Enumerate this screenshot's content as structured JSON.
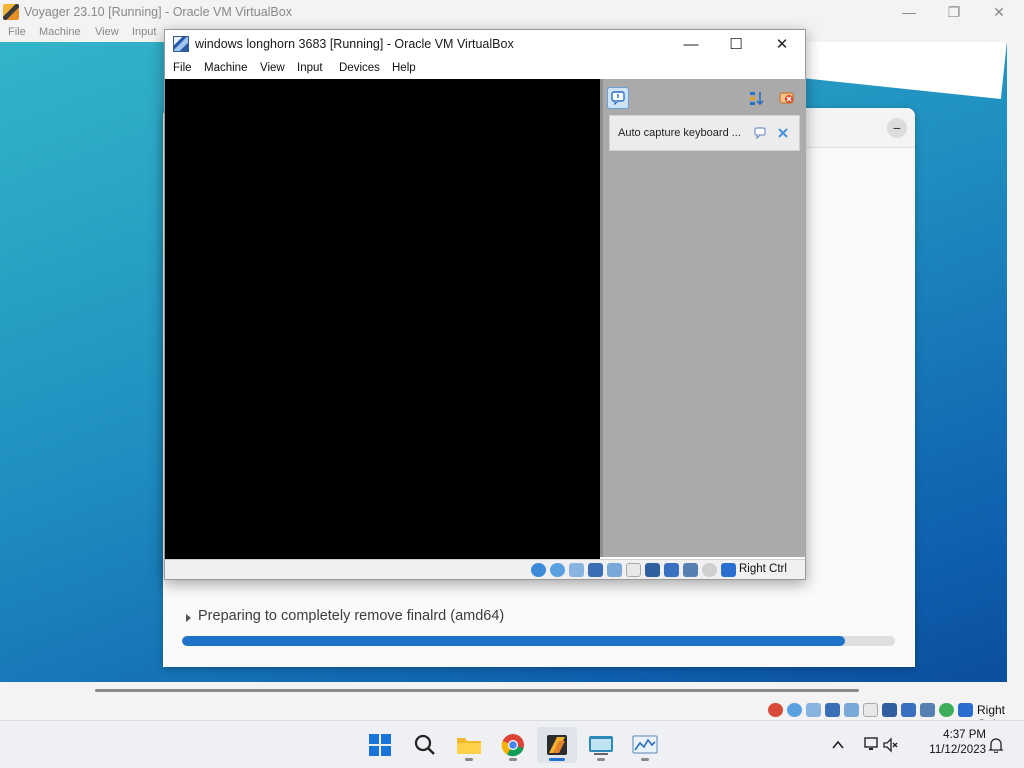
{
  "outer_window": {
    "title": "Voyager 23.10 [Running] - Oracle VM VirtualBox",
    "controls": {
      "minimize": "—",
      "maximize": "❐",
      "close": "✕"
    },
    "menu": [
      "File",
      "Machine",
      "View",
      "Input"
    ],
    "host_key": "Right Ctrl"
  },
  "installer": {
    "minimize_glyph": "−",
    "status_text": "Preparing to completely remove finalrd (amd64)",
    "progress_fraction": 0.93,
    "progress_color": "#1e73c8"
  },
  "inner_window": {
    "title": "windows  longhorn 3683 [Running] - Oracle VM VirtualBox",
    "controls": {
      "minimize": "—",
      "maximize": "☐",
      "close": "✕"
    },
    "menu": [
      "File",
      "Machine",
      "View",
      "Input",
      "Devices",
      "Help"
    ],
    "notification_text": "Auto capture keyboard ...",
    "host_key": "Right Ctrl"
  },
  "taskbar": {
    "apps": [
      "start-icon",
      "search-icon",
      "file-explorer-icon",
      "chrome-icon",
      "virtualbox-icon",
      "terminal-icon",
      "performance-monitor-icon"
    ],
    "tray_chevron": "^",
    "time": "4:37 PM",
    "date": "11/12/2023"
  }
}
